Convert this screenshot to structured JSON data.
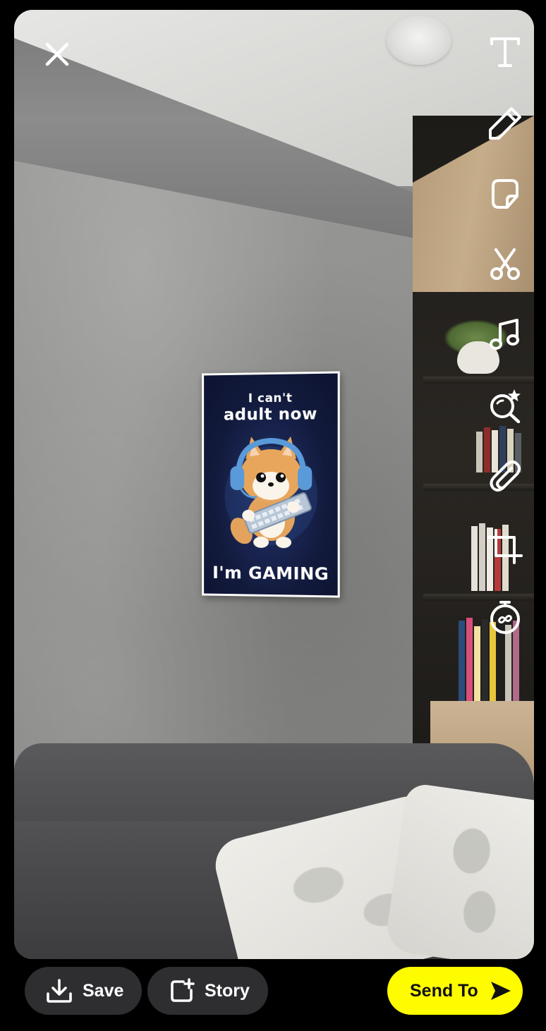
{
  "poster": {
    "line1": "I can't",
    "line2": "adult now",
    "line3": "I'm GAMING"
  },
  "editor": {
    "close_icon": "close-icon",
    "tools": [
      {
        "name": "text-tool",
        "icon": "text-icon"
      },
      {
        "name": "draw-tool",
        "icon": "pencil-icon"
      },
      {
        "name": "sticker-tool",
        "icon": "sticker-icon"
      },
      {
        "name": "scissors-tool",
        "icon": "scissors-icon"
      },
      {
        "name": "music-tool",
        "icon": "music-note-icon"
      },
      {
        "name": "lens-search-tool",
        "icon": "lens-search-icon"
      },
      {
        "name": "attachment-tool",
        "icon": "paperclip-icon"
      },
      {
        "name": "crop-tool",
        "icon": "crop-icon"
      },
      {
        "name": "timer-tool",
        "icon": "timer-icon"
      }
    ]
  },
  "bottom_bar": {
    "save_label": "Save",
    "story_label": "Story",
    "send_label": "Send To"
  },
  "colors": {
    "send_button": "#fffc00",
    "secondary_button": "#2e2e30",
    "background": "#000000"
  }
}
